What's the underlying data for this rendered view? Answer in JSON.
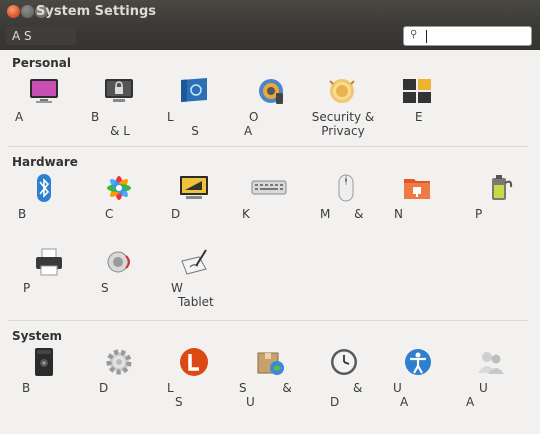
{
  "window": {
    "title": "System Settings"
  },
  "toolbar": {
    "all_settings_label": "A S",
    "search_placeholder": "",
    "search_value": ""
  },
  "sections": {
    "personal": {
      "title": "Personal",
      "items": [
        {
          "line1": "A",
          "line2": "",
          "icon": "appearance-icon"
        },
        {
          "line1": "B",
          "line2": "& L",
          "icon": "lock-screen-icon"
        },
        {
          "line1": "L",
          "line2": "S",
          "icon": "language-flag-icon"
        },
        {
          "line1": "O",
          "line2": "A",
          "icon": "online-accounts-icon"
        },
        {
          "line1": "Security &",
          "line2": "Privacy",
          "icon": "security-privacy-icon"
        },
        {
          "line1": "E",
          "line2": "",
          "icon": "workspaces-icon"
        }
      ]
    },
    "hardware": {
      "title": "Hardware",
      "items": [
        {
          "line1": "B",
          "line2": "",
          "icon": "bluetooth-icon"
        },
        {
          "line1": "C",
          "line2": "",
          "icon": "color-wheel-icon"
        },
        {
          "line1": "D",
          "line2": "",
          "icon": "display-icon"
        },
        {
          "line1": "K",
          "line2": "",
          "icon": "keyboard-icon"
        },
        {
          "line1": "M &",
          "line2": "",
          "icon": "mouse-icon"
        },
        {
          "line1": "N",
          "line2": "",
          "icon": "network-icon"
        },
        {
          "line1": "P",
          "line2": "",
          "icon": "power-icon"
        },
        {
          "line1": "P",
          "line2": "",
          "icon": "printer-icon"
        },
        {
          "line1": "S",
          "line2": "",
          "icon": "sound-icon"
        },
        {
          "line1": "W",
          "line2": "Tablet",
          "icon": "wacom-tablet-icon"
        }
      ]
    },
    "system": {
      "title": "System",
      "items": [
        {
          "line1": "B",
          "line2": "",
          "icon": "backups-icon"
        },
        {
          "line1": "D",
          "line2": "",
          "icon": "details-gear-icon"
        },
        {
          "line1": "L",
          "line2": "S",
          "icon": "landscape-icon"
        },
        {
          "line1": "S &",
          "line2": "U",
          "icon": "software-updates-icon"
        },
        {
          "line1": "&",
          "line2": "D",
          "icon": "time-date-clock-icon"
        },
        {
          "line1": "U",
          "line2": "A",
          "icon": "universal-access-icon"
        },
        {
          "line1": "U",
          "line2": "A",
          "icon": "user-accounts-icon"
        }
      ]
    }
  }
}
